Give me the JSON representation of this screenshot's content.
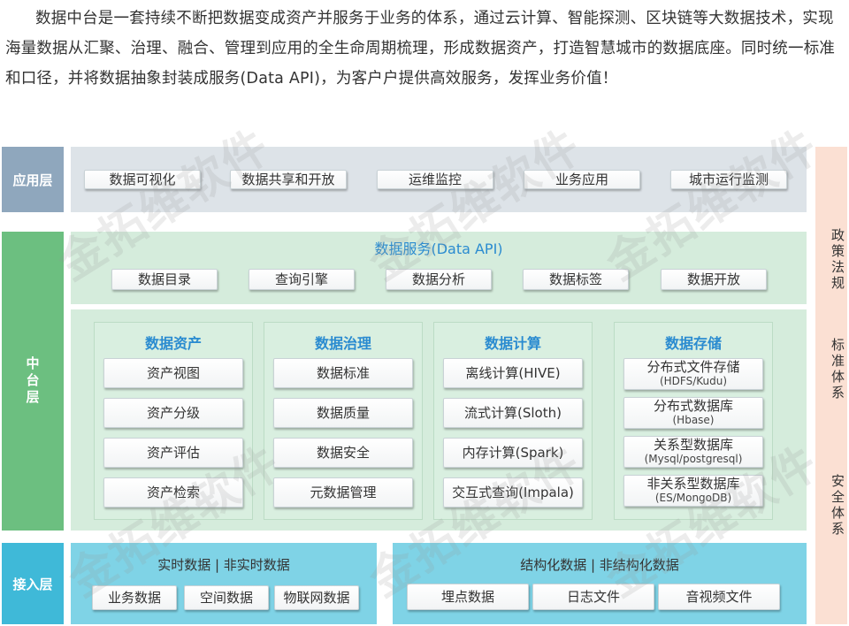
{
  "intro": "数据中台是一套持续不断把数据变成资产并服务于业务的体系，通过云计算、智能探测、区块链等大数据技术，实现海量数据从汇聚、治理、融合、管理到应用的全生命周期梳理，形成数据资产，打造智慧城市的数据底座。同时统一标准和口径，并将数据抽象封装成服务(Data API)，为客户户提供高效服务，发挥业务价值！",
  "layers": {
    "app": "应用层",
    "middle": "中台层",
    "access": "接入层"
  },
  "app_items": [
    "数据可视化",
    "数据共享和开放",
    "运维监控",
    "业务应用",
    "城市运行监测"
  ],
  "service": {
    "title": "数据服务(Data API)",
    "items": [
      "数据目录",
      "查询引擎",
      "数据分析",
      "数据标签",
      "数据开放"
    ]
  },
  "columns": [
    {
      "title": "数据资产",
      "items": [
        {
          "main": "资产视图",
          "sub": ""
        },
        {
          "main": "资产分级",
          "sub": ""
        },
        {
          "main": "资产评估",
          "sub": ""
        },
        {
          "main": "资产检索",
          "sub": ""
        }
      ]
    },
    {
      "title": "数据治理",
      "items": [
        {
          "main": "数据标准",
          "sub": ""
        },
        {
          "main": "数据质量",
          "sub": ""
        },
        {
          "main": "数据安全",
          "sub": ""
        },
        {
          "main": "元数据管理",
          "sub": ""
        }
      ]
    },
    {
      "title": "数据计算",
      "items": [
        {
          "main": "离线计算(HIVE)",
          "sub": ""
        },
        {
          "main": "流式计算(Sloth)",
          "sub": ""
        },
        {
          "main": "内存计算(Spark)",
          "sub": ""
        },
        {
          "main": "交互式查询(Impala)",
          "sub": ""
        }
      ]
    },
    {
      "title": "数据存储",
      "items": [
        {
          "main": "分布式文件存储",
          "sub": "(HDFS/Kudu)"
        },
        {
          "main": "分布式数据库",
          "sub": "(Hbase)"
        },
        {
          "main": "关系型数据库",
          "sub": "(Mysql/postgresql)"
        },
        {
          "main": "非关系型数据库",
          "sub": "(ES/MongoDB)"
        }
      ]
    }
  ],
  "access": {
    "left_title": "实时数据 | 非实时数据",
    "left_items": [
      "业务数据",
      "空间数据",
      "物联网数据"
    ],
    "right_title": "结构化数据 | 非结构化数据",
    "right_items": [
      "埋点数据",
      "日志文件",
      "音视频文件"
    ]
  },
  "side": [
    "政策法规",
    "标准体系",
    "安全体系"
  ],
  "watermark": "金拓维软件",
  "colors": {
    "app_label": "#8fa7bd",
    "app_panel": "#dde3e8",
    "middle_label": "#6cbf80",
    "middle_panel": "#d5ecdc",
    "access_label": "#3fb9d8",
    "access_panel": "#7fd3e6",
    "side_panel": "#fbe0d3",
    "title_blue": "#2a8bd0"
  }
}
